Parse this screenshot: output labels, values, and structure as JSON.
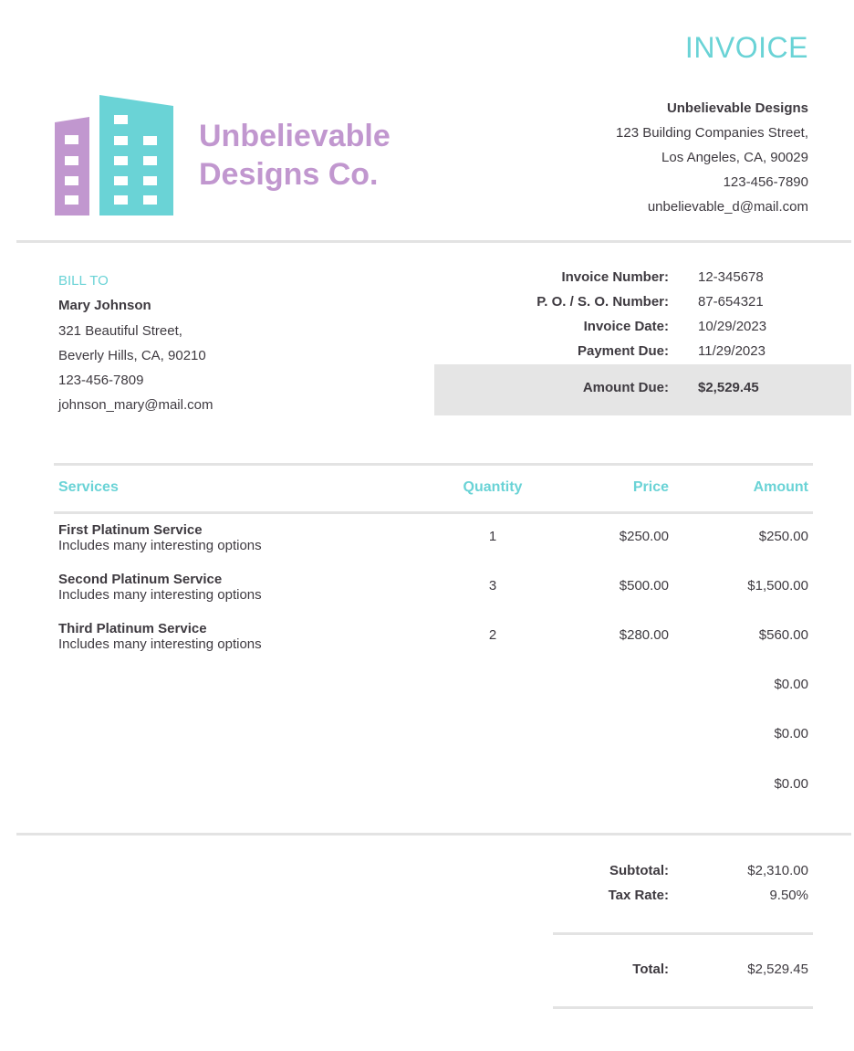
{
  "header": {
    "title": "INVOICE",
    "logo_line1": "Unbelievable",
    "logo_line2": "Designs Co.",
    "logo_icon": "buildings-logo-icon"
  },
  "company": {
    "name": "Unbelievable Designs",
    "street": "123 Building Companies Street,",
    "city": "Los Angeles, CA, 90029",
    "phone": "123-456-7890",
    "email": "unbelievable_d@mail.com"
  },
  "bill_to": {
    "label": "BILL TO",
    "name": "Mary Johnson",
    "street": "321 Beautiful Street,",
    "city": "Beverly Hills, CA, 90210",
    "phone": "123-456-7809",
    "email": "johnson_mary@mail.com"
  },
  "invoice_meta": [
    {
      "label": "Invoice Number:",
      "value": "12-345678"
    },
    {
      "label": "P. O. / S. O. Number:",
      "value": "87-654321"
    },
    {
      "label": "Invoice Date:",
      "value": "10/29/2023"
    },
    {
      "label": "Payment Due:",
      "value": "11/29/2023"
    }
  ],
  "amount_due": {
    "label": "Amount Due:",
    "value": "$2,529.45"
  },
  "table": {
    "headers": {
      "services": "Services",
      "quantity": "Quantity",
      "price": "Price",
      "amount": "Amount"
    },
    "rows": [
      {
        "title": "First Platinum Service",
        "desc": "Includes many interesting options",
        "qty": "1",
        "price": "$250.00",
        "amount": "$250.00"
      },
      {
        "title": "Second Platinum Service",
        "desc": "Includes many interesting options",
        "qty": "3",
        "price": "$500.00",
        "amount": "$1,500.00"
      },
      {
        "title": "Third Platinum Service",
        "desc": "Includes many interesting options",
        "qty": "2",
        "price": "$280.00",
        "amount": "$560.00"
      },
      {
        "title": "",
        "desc": "",
        "qty": "",
        "price": "",
        "amount": "$0.00"
      },
      {
        "title": "",
        "desc": "",
        "qty": "",
        "price": "",
        "amount": "$0.00"
      },
      {
        "title": "",
        "desc": "",
        "qty": "",
        "price": "",
        "amount": "$0.00"
      }
    ]
  },
  "totals": {
    "subtotal_label": "Subtotal:",
    "subtotal": "$2,310.00",
    "tax_label": "Tax Rate:",
    "tax": "9.50%",
    "total_label": "Total:",
    "total": "$2,529.45"
  },
  "colors": {
    "accent": "#6ad3d6",
    "logo_purple": "#c197cf",
    "text": "#3e3a40",
    "rule": "#e3e3e3"
  }
}
